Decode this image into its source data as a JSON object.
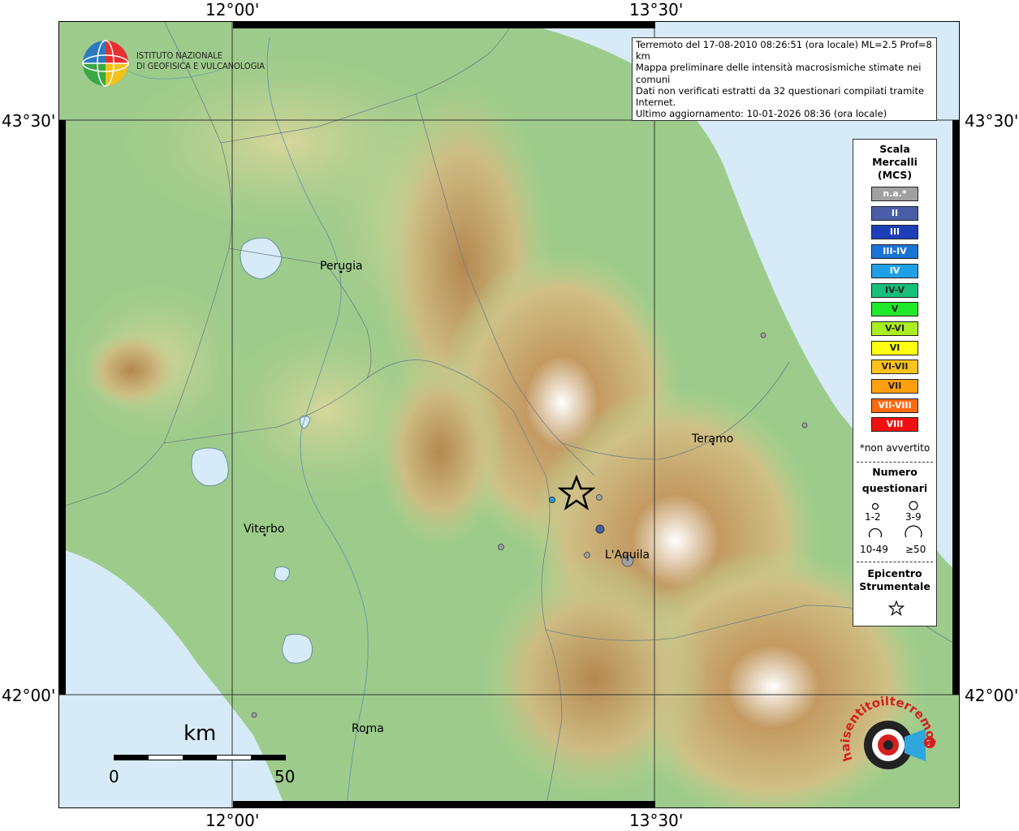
{
  "header": {
    "logo": "INGV globe logo",
    "org_line1": "ISTITUTO NAZIONALE",
    "org_line2": "DI GEOFISICA E VULCANOLOGIA"
  },
  "axes": {
    "top_lon_left": "12°00'",
    "top_lon_right": "13°30'",
    "bottom_lon_left": "12°00'",
    "bottom_lon_right": "13°30'",
    "left_lat_top": "43°30'",
    "left_lat_bottom": "42°00'",
    "right_lat_top": "43°30'",
    "right_lat_bottom": "42°00'"
  },
  "info": {
    "line1": "Terremoto del 17-08-2010 08:26:51 (ora locale) ML=2.5 Prof=8 km",
    "line2": "Mappa preliminare delle intensità macrosismiche stimate nei comuni",
    "line3": "Dati non verificati estratti da 32 questionari compilati tramite Internet.",
    "line4": "Ultimo aggiornamento: 10-01-2026 08:36 (ora locale)"
  },
  "cities": {
    "perugia": "Perugia",
    "teramo": "Teramo",
    "viterbo": "Viterbo",
    "laquila": "L'Aquila",
    "roma": "Roma"
  },
  "legend": {
    "title1": "Scala",
    "title2": "Mercalli",
    "title3": "(MCS)",
    "classes": [
      {
        "label": "n.a.*",
        "color": "#a0a0a0"
      },
      {
        "label": "II",
        "color": "#4a5ea8"
      },
      {
        "label": "III",
        "color": "#1c3fb8"
      },
      {
        "label": "III-IV",
        "color": "#1a74d6"
      },
      {
        "label": "IV",
        "color": "#1fa0e6"
      },
      {
        "label": "IV-V",
        "color": "#17c07a"
      },
      {
        "label": "V",
        "color": "#22e82a"
      },
      {
        "label": "V-VI",
        "color": "#aaee22"
      },
      {
        "label": "VI",
        "color": "#ffff10"
      },
      {
        "label": "VI-VII",
        "color": "#ffc21a"
      },
      {
        "label": "VII",
        "color": "#ffa010"
      },
      {
        "label": "VII-VIII",
        "color": "#ff6a10"
      },
      {
        "label": "VIII",
        "color": "#f01010"
      }
    ],
    "na_note": "*non avvertito",
    "numero1": "Numero",
    "numero2": "questionari",
    "size_labels": [
      "1-2",
      "3-9",
      "10-49",
      "≥50"
    ],
    "epi1": "Epicentro",
    "epi2": "Strumentale"
  },
  "scale": {
    "unit": "km",
    "min": "0",
    "max": "50"
  },
  "points": [
    {
      "name": "epicentre",
      "intensity": "epicentro"
    },
    {
      "name": "p1",
      "intensity": "IV",
      "color": "#1fa0e6"
    },
    {
      "name": "p2",
      "intensity": "n.a.*",
      "color": "#a0a0a0"
    },
    {
      "name": "p3",
      "intensity": "II",
      "color": "#4a5ea8"
    },
    {
      "name": "p4",
      "intensity": "n.a.*",
      "color": "#a0a0a0"
    },
    {
      "name": "p5",
      "intensity": "n.a.*",
      "color": "#a0a0a0"
    },
    {
      "name": "p6",
      "intensity": "n.a.*",
      "color": "#a0a0a0"
    }
  ],
  "colors": {
    "sea": "#d6ebf7",
    "lowland": "#8fc485",
    "hills": "#c9d89a",
    "mountain": "#c49a5e",
    "peak": "#f2efe8"
  },
  "badge": {
    "text": "haisentitoilterremoto.it",
    "url": "WWW."
  }
}
